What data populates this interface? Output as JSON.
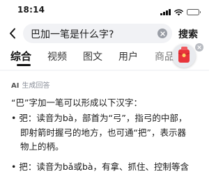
{
  "status_bar": {
    "time": "18:14"
  },
  "search": {
    "query": "巴加一笔是什么字?",
    "search_button_label": "搜索"
  },
  "tabs": [
    {
      "label": "综合",
      "active": true
    },
    {
      "label": "视频",
      "active": false
    },
    {
      "label": "图文",
      "active": false
    },
    {
      "label": "用户",
      "active": false
    },
    {
      "label": "商品",
      "active": false
    }
  ],
  "answer": {
    "ai_badge": "AI",
    "ai_label": "生成回答",
    "intro": "“巴”字加一笔可以形成以下汉字：",
    "bullets": [
      {
        "lines": [
          "• 弝：读音为bà，部首为“弓”，指弓的中部，",
          "即射箭时握弓的地方，也可通“把”，表示器",
          "物上的柄。"
        ]
      },
      {
        "lines": [
          "• 把：读音为bǎ或bà，有拿、抓住、控制等含"
        ]
      }
    ]
  },
  "colors": {
    "accent_red": "#e8343a",
    "search_bg": "#f1f2f5",
    "muted_text": "#8a8f99"
  },
  "icons": [
    "back-arrow-icon",
    "clear-icon",
    "red-envelope-icon",
    "close-icon",
    "wifi-icon",
    "signal-icon",
    "battery-icon"
  ]
}
